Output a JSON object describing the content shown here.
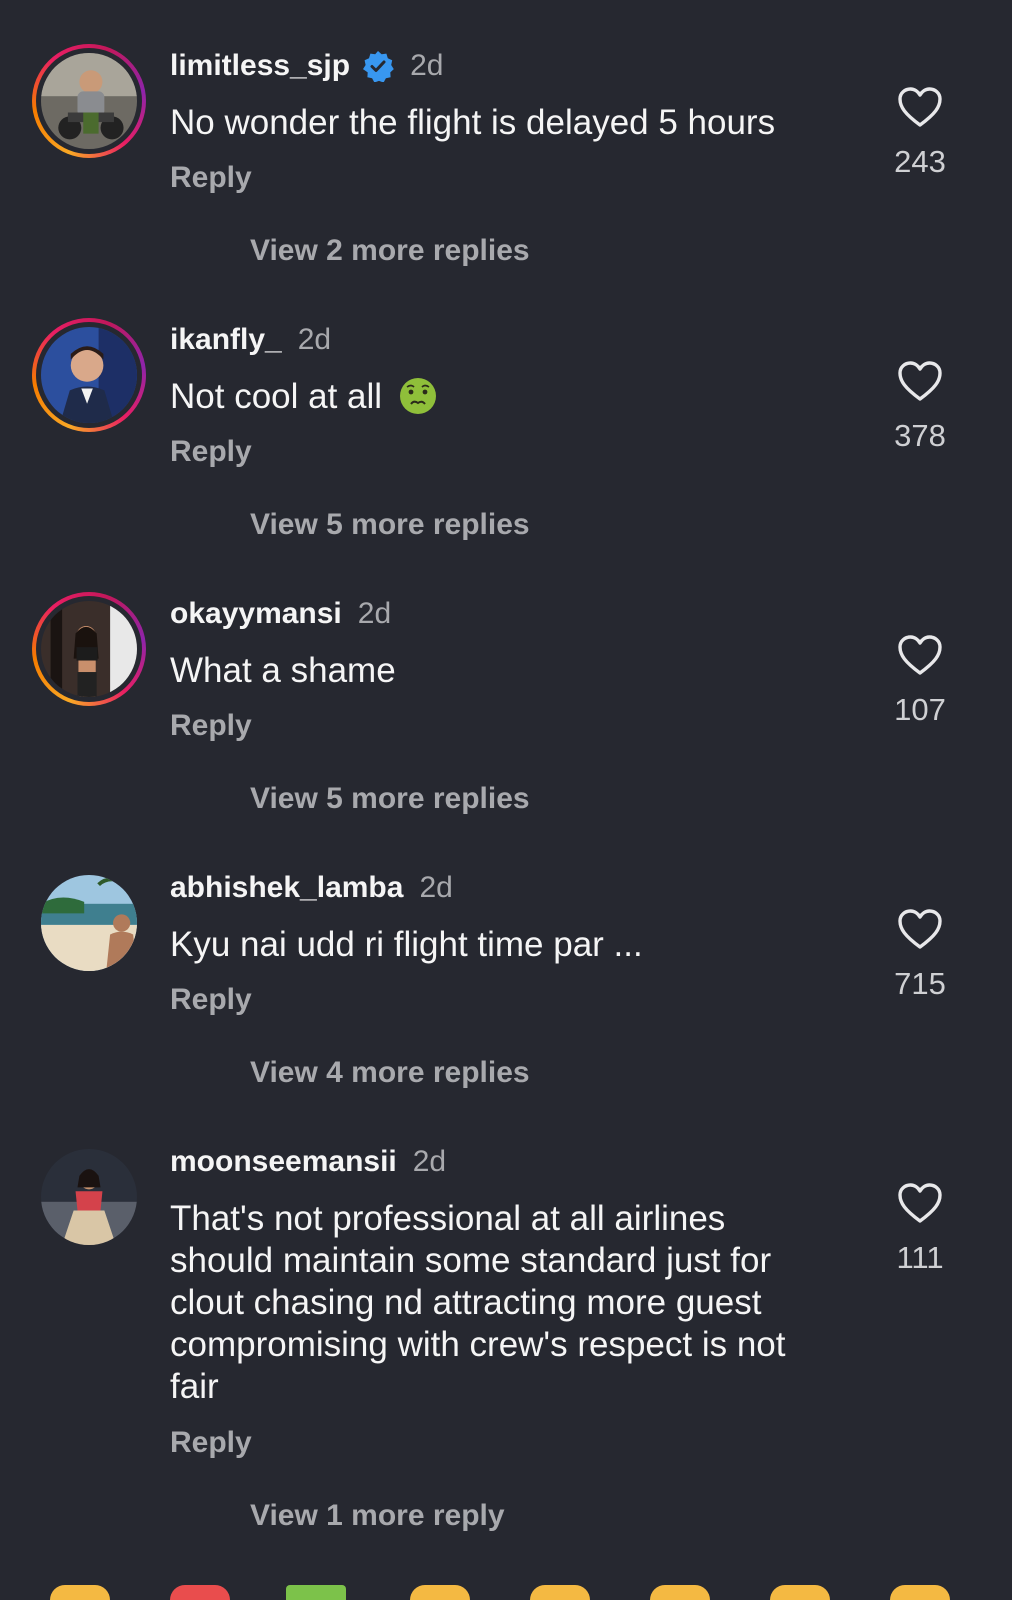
{
  "comments": [
    {
      "username": "limitless_sjp",
      "verified": true,
      "time": "2d",
      "text": "No wonder the flight is delayed 5 hours",
      "reply_label": "Reply",
      "likes": "243",
      "more_replies": "View 2 more replies"
    },
    {
      "username": "ikanfly_",
      "verified": false,
      "time": "2d",
      "text": "Not cool at all",
      "emoji": "nauseated-face",
      "reply_label": "Reply",
      "likes": "378",
      "more_replies": "View 5 more replies"
    },
    {
      "username": "okayymansi",
      "verified": false,
      "time": "2d",
      "text": "What a shame",
      "reply_label": "Reply",
      "likes": "107",
      "more_replies": "View 5 more replies"
    },
    {
      "username": "abhishek_lamba",
      "verified": false,
      "time": "2d",
      "text": "Kyu nai udd ri flight time par ...",
      "reply_label": "Reply",
      "likes": "715",
      "more_replies": "View 4 more replies"
    },
    {
      "username": "moonseemansii",
      "verified": false,
      "time": "2d",
      "text": "That's not professional at all airlines should maintain some standard just for clout chasing nd attracting more guest compromising with crew's respect is not fair",
      "reply_label": "Reply",
      "likes": "111",
      "more_replies": "View 1 more reply"
    }
  ],
  "colors": {
    "background": "#262830",
    "primary_text": "#f5f5f5",
    "secondary_text": "#a8a9ad",
    "verified_badge": "#3897f0"
  },
  "icons": {
    "like": "heart-outline-icon",
    "verified": "verified-badge-icon"
  }
}
